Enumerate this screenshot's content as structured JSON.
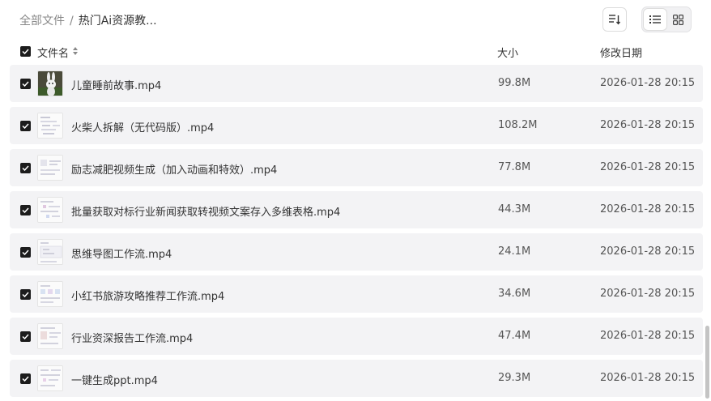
{
  "breadcrumb": {
    "root": "全部文件",
    "separator": "/",
    "current": "热门Ai资源教..."
  },
  "columns": {
    "name": "文件名",
    "size": "大小",
    "modified": "修改日期"
  },
  "files": [
    {
      "name": "儿童睡前故事.mp4",
      "size": "99.8M",
      "modified": "2026-01-28 20:15",
      "thumb": "rabbit"
    },
    {
      "name": "火柴人拆解（无代码版）.mp4",
      "size": "108.2M",
      "modified": "2026-01-28 20:15",
      "thumb": "doc"
    },
    {
      "name": "励志减肥视频生成（加入动画和特效）.mp4",
      "size": "77.8M",
      "modified": "2026-01-28 20:15",
      "thumb": "doc"
    },
    {
      "name": "批量获取对标行业新闻获取转视频文案存入多维表格.mp4",
      "size": "44.3M",
      "modified": "2026-01-28 20:15",
      "thumb": "doc"
    },
    {
      "name": "思维导图工作流.mp4",
      "size": "24.1M",
      "modified": "2026-01-28 20:15",
      "thumb": "doc"
    },
    {
      "name": "小红书旅游攻略推荐工作流.mp4",
      "size": "34.6M",
      "modified": "2026-01-28 20:15",
      "thumb": "doc"
    },
    {
      "name": "行业资深报告工作流.mp4",
      "size": "47.4M",
      "modified": "2026-01-28 20:15",
      "thumb": "doc"
    },
    {
      "name": "一键生成ppt.mp4",
      "size": "29.3M",
      "modified": "2026-01-28 20:15",
      "thumb": "doc"
    }
  ],
  "colors": {
    "row_bg": "#f3f3f5",
    "checkbox": "#1c1c1c",
    "scrollbar": "#c4c4c4"
  },
  "icons": {
    "sort_button": "sort-lines-icon",
    "list_view": "list-view-icon",
    "grid_view": "grid-view-icon",
    "column_sort": "updown-arrows-icon"
  }
}
